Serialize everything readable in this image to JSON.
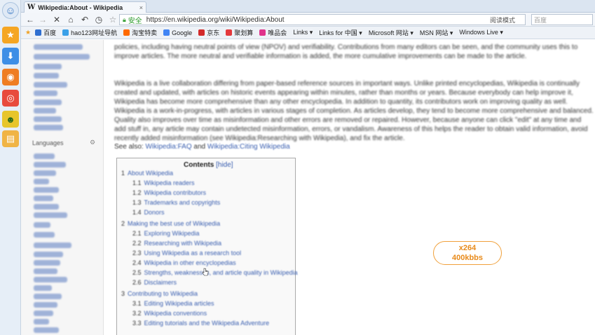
{
  "tab": {
    "title": "Wikipedia:About - Wikipedia",
    "close": "×"
  },
  "toolbar": {
    "back": "←",
    "forward": "→",
    "stop": "✕",
    "home": "⌂",
    "undo": "↶",
    "history": "◷",
    "star": "☆",
    "safe_label": "安全",
    "url": "https://en.wikipedia.org/wiki/Wikipedia:About",
    "reading_mode": "阅读模式",
    "search_placeholder": "百度"
  },
  "bookmarks": [
    {
      "label": "百度",
      "color": "#2f6fd0"
    },
    {
      "label": "hao123网址导航",
      "color": "#3aa0e8"
    },
    {
      "label": "淘宝特卖",
      "color": "#ff6a00"
    },
    {
      "label": "Google",
      "color": "#4285f4"
    },
    {
      "label": "京东",
      "color": "#d22a2a"
    },
    {
      "label": "聚划算",
      "color": "#e4393c"
    },
    {
      "label": "唯品会",
      "color": "#e0338b"
    },
    {
      "label": "Links ▾",
      "color": ""
    },
    {
      "label": "Links for 中国 ▾",
      "color": ""
    },
    {
      "label": "Microsoft 网站 ▾",
      "color": ""
    },
    {
      "label": "MSN 网站 ▾",
      "color": ""
    },
    {
      "label": "Windows Live ▾",
      "color": ""
    }
  ],
  "sidebar": {
    "languages_heading": "Languages"
  },
  "content": {
    "para1": "policies, including having neutral points of view (NPOV) and verifiability. Contributions from many editors can be seen, and the community uses this to improve articles. The more neutral and verifiable information is added, the more cumulative improvements can be made to the article.",
    "para2": "Wikipedia is a live collaboration differing from paper-based reference sources in important ways. Unlike printed encyclopedias, Wikipedia is continually created and updated, with articles on historic events appearing within minutes, rather than months or years. Because everybody can help improve it, Wikipedia has become more comprehensive than any other encyclopedia. In addition to quantity, its contributors work on improving quality as well. Wikipedia is a work-in-progress, with articles in various stages of completion. As articles develop, they tend to become more comprehensive and balanced. Quality also improves over time as misinformation and other errors are removed or repaired. However, because anyone can click \"edit\" at any time and add stuff in, any article may contain undetected misinformation, errors, or vandalism. Awareness of this helps the reader to obtain valid information, avoid recently added misinformation (see Wikipedia:Researching with Wikipedia), and fix the article.",
    "seealso_prefix": "See also: ",
    "seealso_link1": "Wikipedia:FAQ",
    "seealso_mid": " and ",
    "seealso_link2": "Wikipedia:Citing Wikipedia"
  },
  "toc": {
    "title": "Contents",
    "hide": "[hide]",
    "items": [
      {
        "n": "1",
        "t": "About Wikipedia",
        "l": 1
      },
      {
        "n": "1.1",
        "t": "Wikipedia readers",
        "l": 2
      },
      {
        "n": "1.2",
        "t": "Wikipedia contributors",
        "l": 2
      },
      {
        "n": "1.3",
        "t": "Trademarks and copyrights",
        "l": 2
      },
      {
        "n": "1.4",
        "t": "Donors",
        "l": 2
      },
      {
        "n": "2",
        "t": "Making the best use of Wikipedia",
        "l": 1
      },
      {
        "n": "2.1",
        "t": "Exploring Wikipedia",
        "l": 2
      },
      {
        "n": "2.2",
        "t": "Researching with Wikipedia",
        "l": 2
      },
      {
        "n": "2.3",
        "t": "Using Wikipedia as a research tool",
        "l": 2
      },
      {
        "n": "2.4",
        "t": "Wikipedia in other encyclopedias",
        "l": 2
      },
      {
        "n": "2.5",
        "t": "Strengths, weaknesses, and article quality in Wikipedia",
        "l": 2
      },
      {
        "n": "2.6",
        "t": "Disclaimers",
        "l": 2
      },
      {
        "n": "3",
        "t": "Contributing to Wikipedia",
        "l": 1
      },
      {
        "n": "3.1",
        "t": "Editing Wikipedia articles",
        "l": 2
      },
      {
        "n": "3.2",
        "t": "Wikipedia conventions",
        "l": 2
      },
      {
        "n": "3.3",
        "t": "Editing tutorials and the Wikipedia Adventure",
        "l": 2
      }
    ]
  },
  "overlay": {
    "line1": "x264",
    "line2": "400kbbs"
  }
}
